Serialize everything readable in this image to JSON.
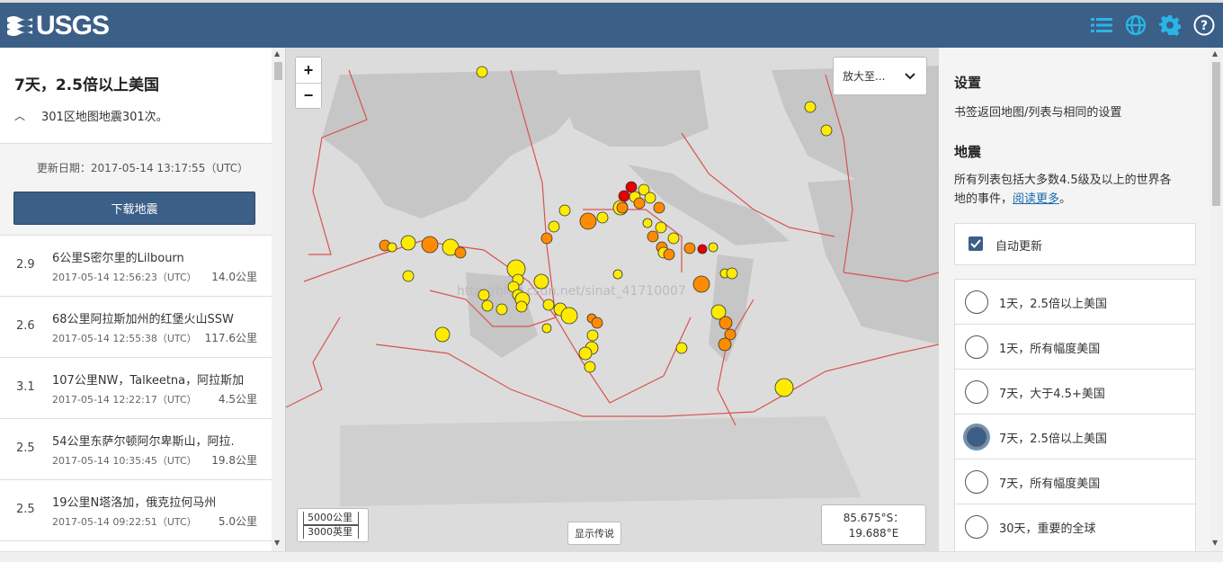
{
  "header": {
    "logo_text": "USGS",
    "icons": [
      "list-icon",
      "globe-icon",
      "gear-icon",
      "help-icon"
    ],
    "accent": "#3b5f87",
    "icon_color": "#29b6e6"
  },
  "left": {
    "title": "7天，2.5倍以上美国",
    "subtitle": "301区地图地震301次。",
    "updated": "更新日期：2017-05-14 13:17:55（UTC）",
    "download_label": "下载地震",
    "earthquakes": [
      {
        "mag": "2.9",
        "place": "6公里S密尔里的Lilbourn",
        "time": "2017-05-14 12:56:23（UTC）",
        "depth": "14.0公里"
      },
      {
        "mag": "2.6",
        "place": "68公里阿拉斯加州的红堡火山SSW",
        "time": "2017-05-14 12:55:38（UTC）",
        "depth": "117.6公里"
      },
      {
        "mag": "3.1",
        "place": "107公里NW，Talkeetna，阿拉斯加",
        "time": "2017-05-14 12:22:17（UTC）",
        "depth": "4.5公里"
      },
      {
        "mag": "2.5",
        "place": "54公里东萨尔顿阿尔卑斯山，阿拉.",
        "time": "2017-05-14 10:35:45（UTC）",
        "depth": "19.8公里"
      },
      {
        "mag": "2.5",
        "place": "19公里N塔洛加，俄克拉何马州",
        "time": "2017-05-14 09:22:51（UTC）",
        "depth": "5.0公里"
      }
    ]
  },
  "map": {
    "zoom_in": "+",
    "zoom_out": "−",
    "zoom_to": "放大至...",
    "scale_km": "5000公里",
    "scale_mi": "3000英里",
    "legend_label": "显示传说",
    "coord_lat": "85.675°S：",
    "coord_lon": "19.688°E",
    "watermark": "http://blog.csdn.net/sinat_41710007",
    "plate_color": "#d9534f",
    "quake_colors": {
      "yellow": "#ffeb00",
      "orange": "#ff8c00",
      "red": "#e60000"
    }
  },
  "settings": {
    "title": "设置",
    "desc": "书签返回地图/列表与相同的设置",
    "eq_heading": "地震",
    "eq_desc_1": "所有列表包括大多数4.5级及以上的世界各",
    "eq_desc_2": "地的事件，",
    "read_more": "阅读更多",
    "eq_desc_end": "。",
    "auto_update": "自动更新",
    "feeds": [
      {
        "label": "1天，2.5倍以上美国",
        "selected": false
      },
      {
        "label": "1天，所有幅度美国",
        "selected": false
      },
      {
        "label": "7天，大于4.5+美国",
        "selected": false
      },
      {
        "label": "7天，2.5倍以上美国",
        "selected": true
      },
      {
        "label": "7天，所有幅度美国",
        "selected": false
      },
      {
        "label": "30天，重要的全球",
        "selected": false
      }
    ]
  }
}
